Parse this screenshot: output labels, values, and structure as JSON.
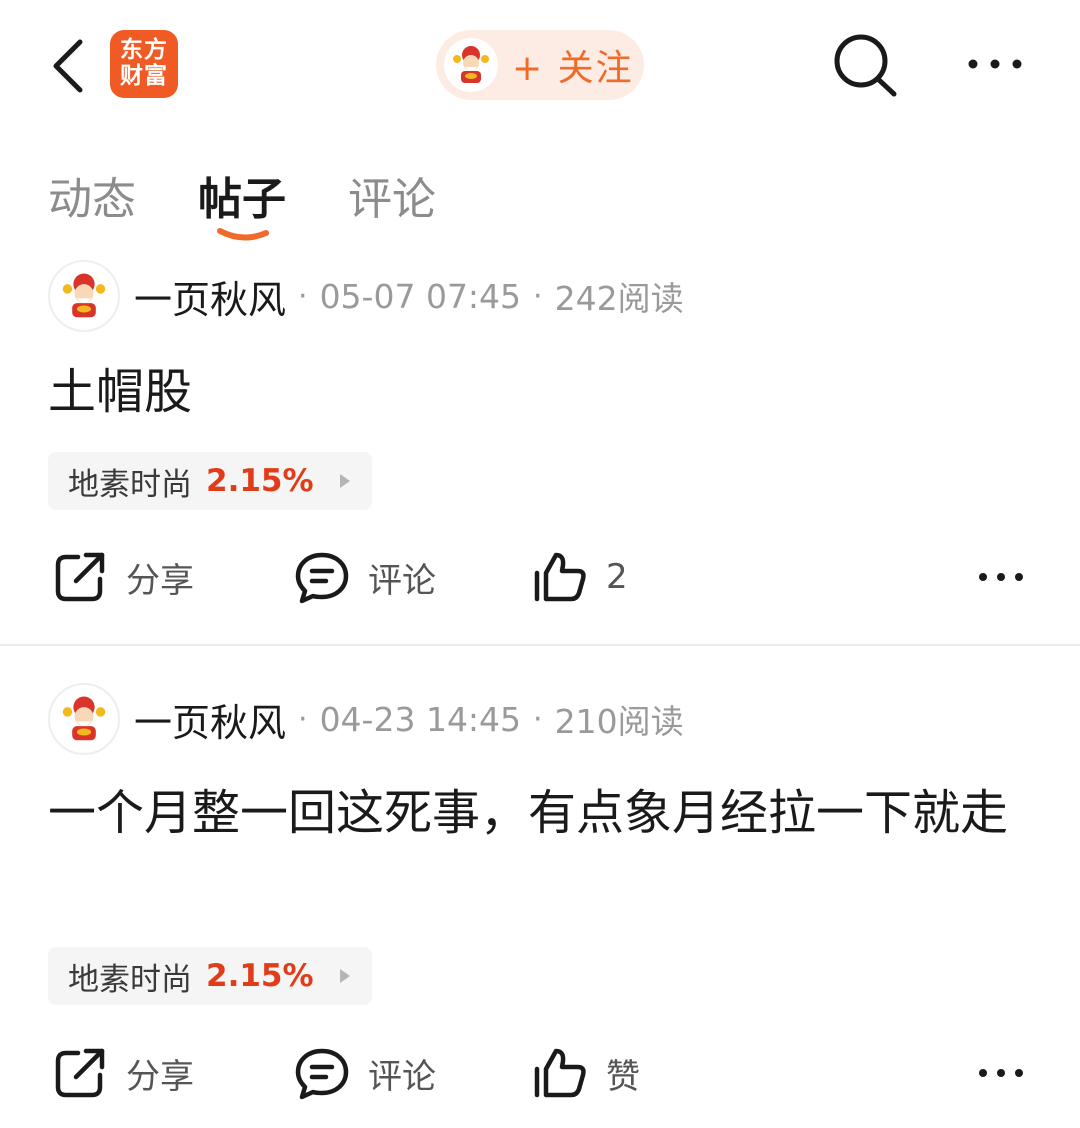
{
  "header": {
    "logo_line1": "东方",
    "logo_line2": "财富",
    "follow_label": "+ 关注",
    "icons": [
      "chevron-left-icon",
      "search-icon",
      "more-horizontal-icon"
    ],
    "accent_color": "#f06a2a",
    "logo_color": "#f05a24"
  },
  "tabs": [
    {
      "label": "动态",
      "active": false
    },
    {
      "label": "帖子",
      "active": true
    },
    {
      "label": "评论",
      "active": false
    }
  ],
  "posts": [
    {
      "author": "一页秋风",
      "time": "05-07 07:45",
      "reads": "242阅读",
      "content": "土帽股",
      "stock_name": "地素时尚",
      "stock_change": "2.15%",
      "share_label": "分享",
      "comment_label": "评论",
      "like_label": "2"
    },
    {
      "author": "一页秋风",
      "time": "04-23 14:45",
      "reads": "210阅读",
      "content": "一个月整一回这死事，有点象月经拉一下就走",
      "stock_name": "地素时尚",
      "stock_change": "2.15%",
      "share_label": "分享",
      "comment_label": "评论",
      "like_label": "赞"
    }
  ],
  "colors": {
    "stock_up": "#e03c1a",
    "muted_text": "#9a9a9a"
  }
}
